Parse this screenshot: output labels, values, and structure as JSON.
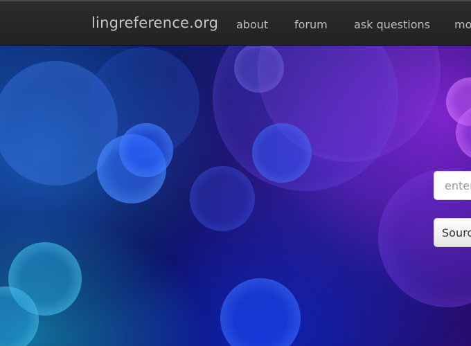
{
  "navbar": {
    "brand": "lingreference.org",
    "links": [
      "about",
      "forum",
      "ask questions",
      "mo"
    ]
  },
  "hero": {
    "search_placeholder": "enter",
    "source_button_label": "Sourc"
  },
  "colors": {
    "navbar_bg": "#252525",
    "nav_text": "#bdbdbd",
    "hero_blue": "#1a3fd0",
    "hero_purple": "#8a2be2"
  }
}
